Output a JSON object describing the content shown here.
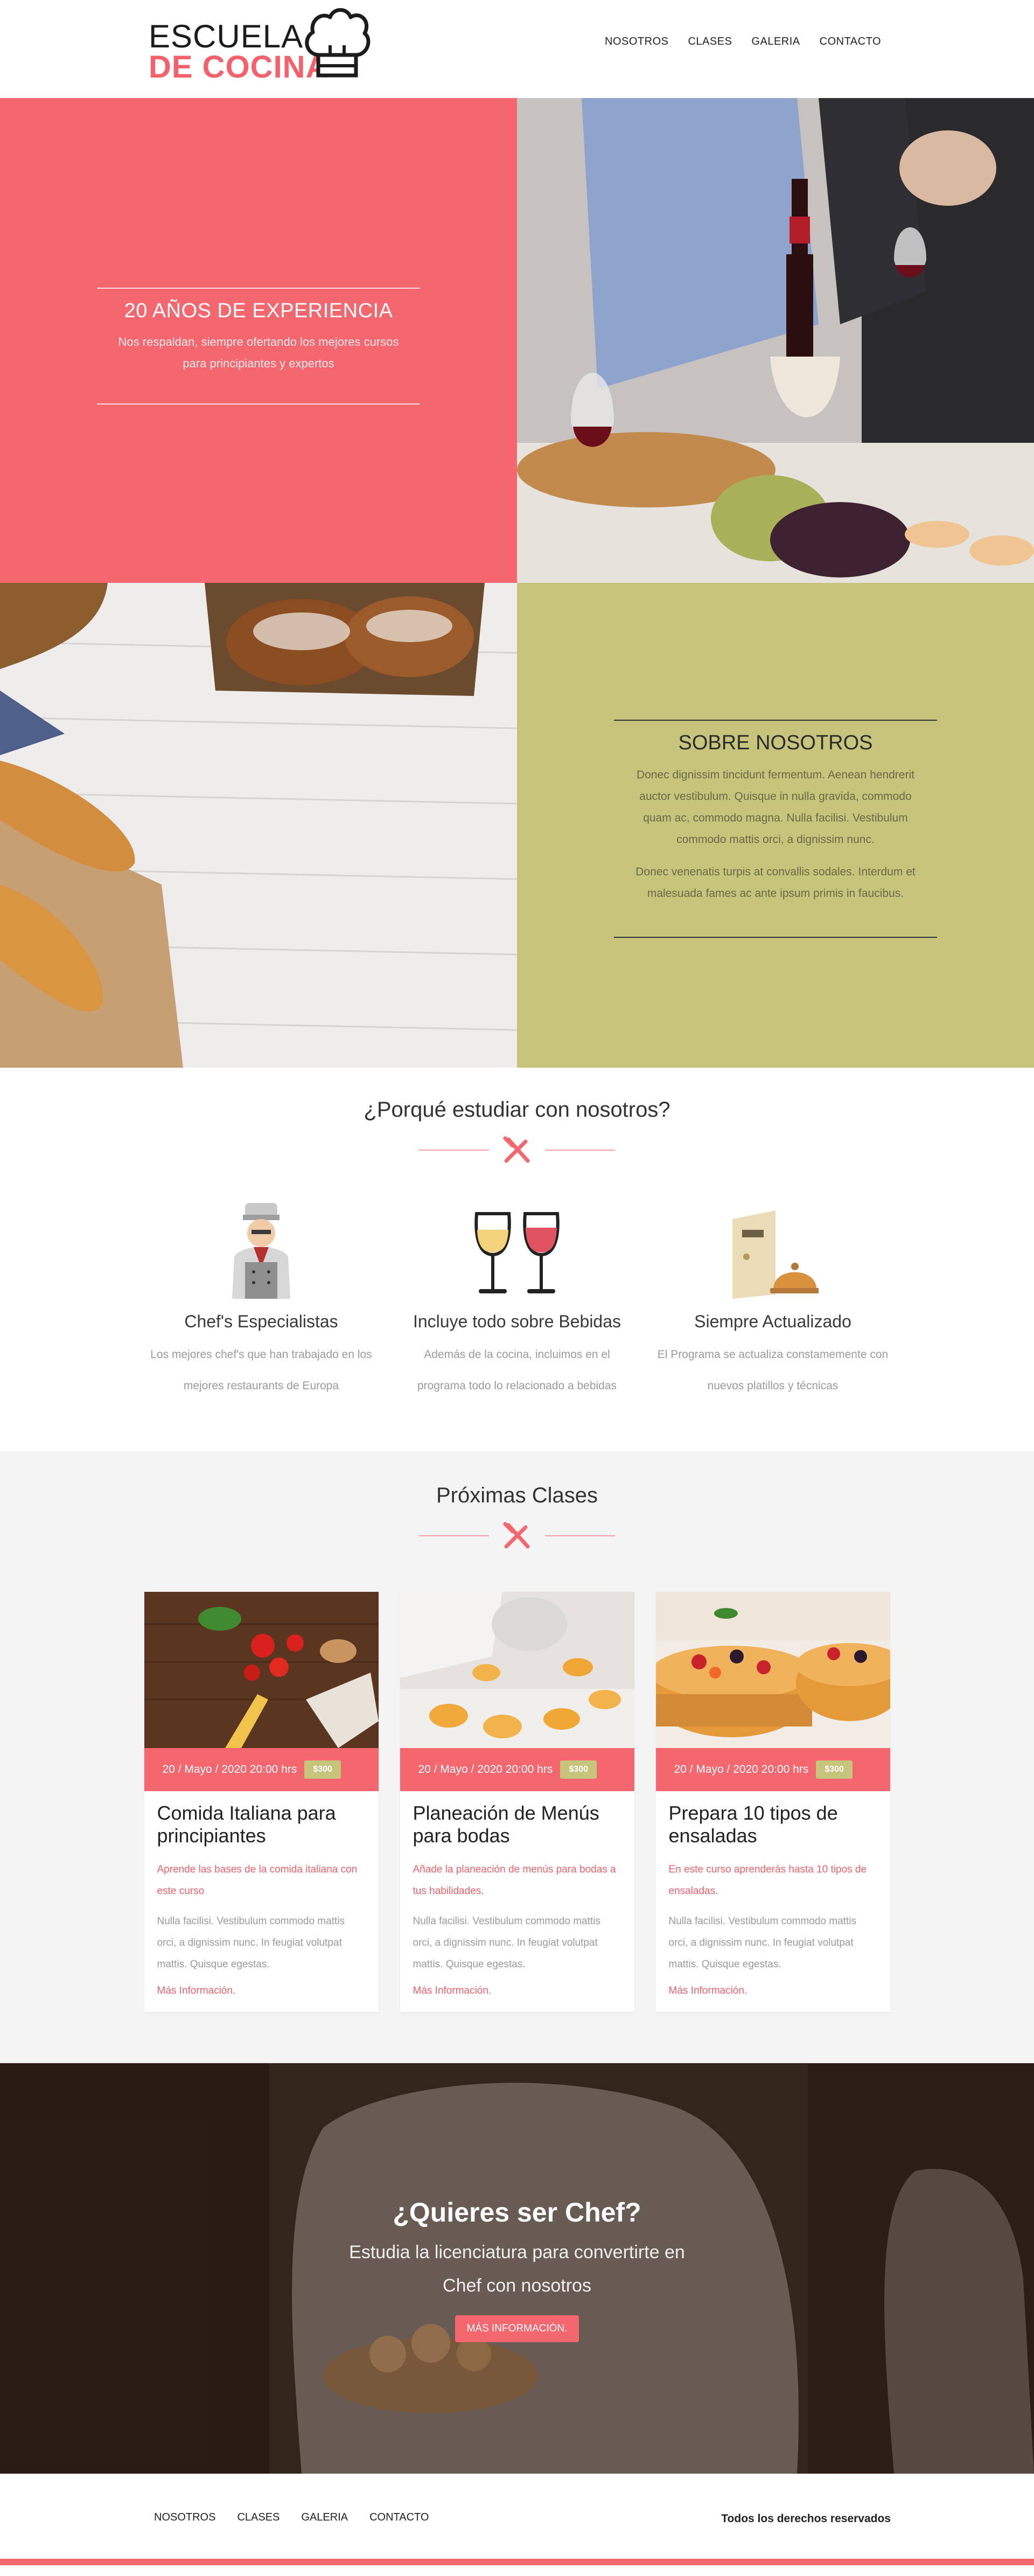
{
  "brand": {
    "line1": "ESCUELA",
    "line2": "DE COCINA"
  },
  "nav": [
    "NOSOTROS",
    "CLASES",
    "GALERIA",
    "CONTACTO"
  ],
  "experience": {
    "title": "20 AÑOS DE EXPERIENCIA",
    "text": "Nos respaldan, siempre ofertando los mejores cursos para principiantes y expertos"
  },
  "about": {
    "title": "SOBRE NOSOTROS",
    "p1": "Donec dignissim tincidunt fermentum. Aenean hendrerit auctor vestibulum. Quisque in nulla gravida, commodo quam ac, commodo magna. Nulla facilisi. Vestibulum commodo mattis orci, a dignissim nunc.",
    "p2": "Donec venenatis turpis at convallis sodales. Interdum et malesuada fames ac ante ipsum primis in faucibus."
  },
  "why": {
    "title": "¿Porqué estudiar con nosotros?",
    "features": [
      {
        "title": "Chef's Especialistas",
        "text": "Los mejores chef's que han trabajado en los mejores restaurants de Europa"
      },
      {
        "title": "Incluye todo sobre Bebidas",
        "text": "Además de la cocina, incluimos en el programa todo lo relacionado a bebidas"
      },
      {
        "title": "Siempre Actualizado",
        "text": "El Programa se actualiza constamemente con nuevos platillos y técnicas"
      }
    ]
  },
  "classes": {
    "title": "Próximas Clases",
    "cards": [
      {
        "date": "20 / Mayo / 2020 20:00 hrs",
        "price": "$300",
        "title": "Comida Italiana para principiantes",
        "lead": "Aprende las bases de la comida italiana con este curso",
        "text": "Nulla facilisi. Vestibulum commodo mattis orci, a dignissim nunc. In feugiat volutpat mattis. Quisque egestas.",
        "link": "Más Información."
      },
      {
        "date": "20 / Mayo / 2020 20:00 hrs",
        "price": "$300",
        "title": "Planeación de Menús para bodas",
        "lead": "Añade la planeación de menús para bodas a tus habilidades.",
        "text": "Nulla facilisi. Vestibulum commodo mattis orci, a dignissim nunc. In feugiat volutpat mattis. Quisque egestas.",
        "link": "Más Información."
      },
      {
        "date": "20 / Mayo / 2020 20:00 hrs",
        "price": "$300",
        "title": "Prepara 10 tipos de ensaladas",
        "lead": "En este curso aprenderás hasta 10 tipos de ensaladas.",
        "text": "Nulla facilisi. Vestibulum commodo mattis orci, a dignissim nunc. In feugiat volutpat mattis. Quisque egestas.",
        "link": "Más Información."
      }
    ]
  },
  "cta": {
    "title": "¿Quieres ser Chef?",
    "text": "Estudia la licenciatura para convertirte en Chef con nosotros",
    "button": "MÁS INFORMACIÓN."
  },
  "footer": {
    "nav": [
      "NOSOTROS",
      "CLASES",
      "GALERIA",
      "CONTACTO"
    ],
    "copyright": "Todos los derechos reservados"
  },
  "colors": {
    "accent": "#f4676f",
    "olive": "#c7c57b"
  }
}
